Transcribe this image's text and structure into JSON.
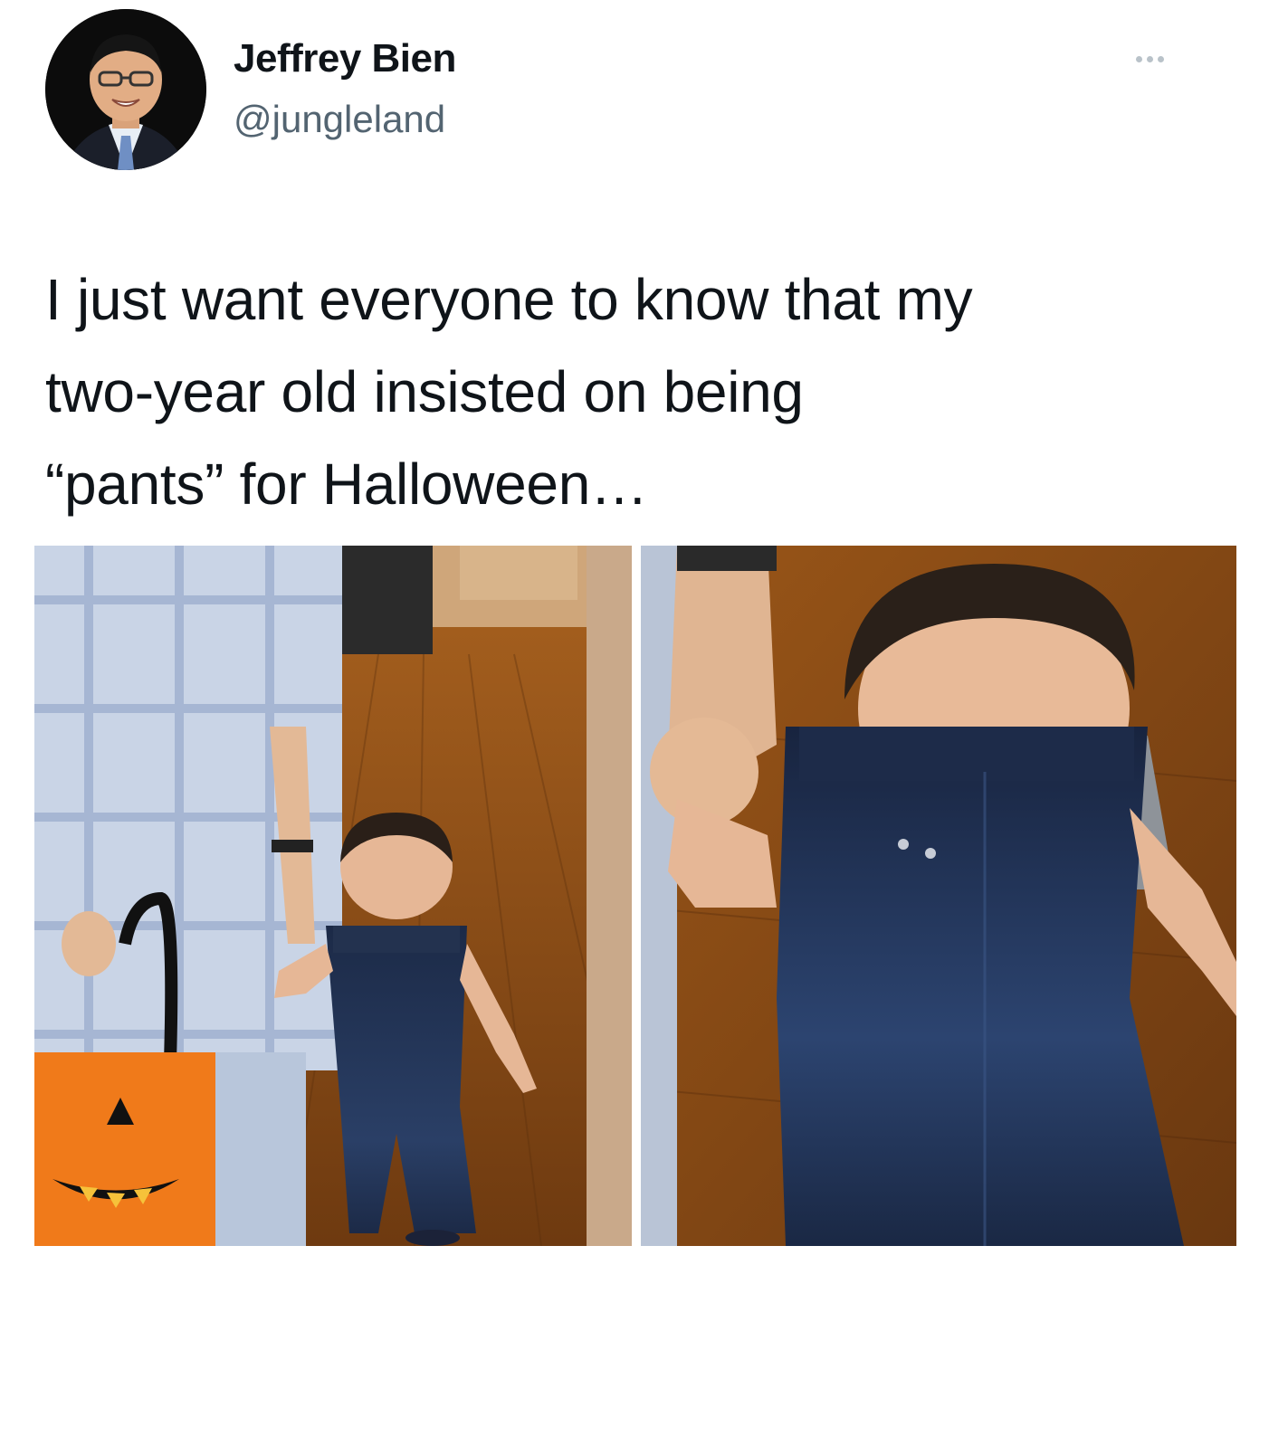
{
  "tweet": {
    "author": {
      "display_name": "Jeffrey Bien",
      "handle": "@jungleland",
      "avatar_icon": "avatar-photo"
    },
    "more_icon": "more-horizontal-icon",
    "text_lines": [
      "I just want everyone to know that my",
      "two-year old insisted on being",
      "“pants” for Halloween…"
    ],
    "media": [
      {
        "kind": "photo",
        "subject": "toddler walking in jeans holding adult's hand, orange pumpkin bag"
      },
      {
        "kind": "photo",
        "subject": "close-up of toddler wearing jeans pulled up to shoulders"
      }
    ],
    "colors": {
      "text": "#0f1419",
      "secondary": "#536471",
      "floor": "#8a4a14",
      "denim": "#1f2d4a",
      "pumpkin_bag": "#f07a1a"
    }
  }
}
